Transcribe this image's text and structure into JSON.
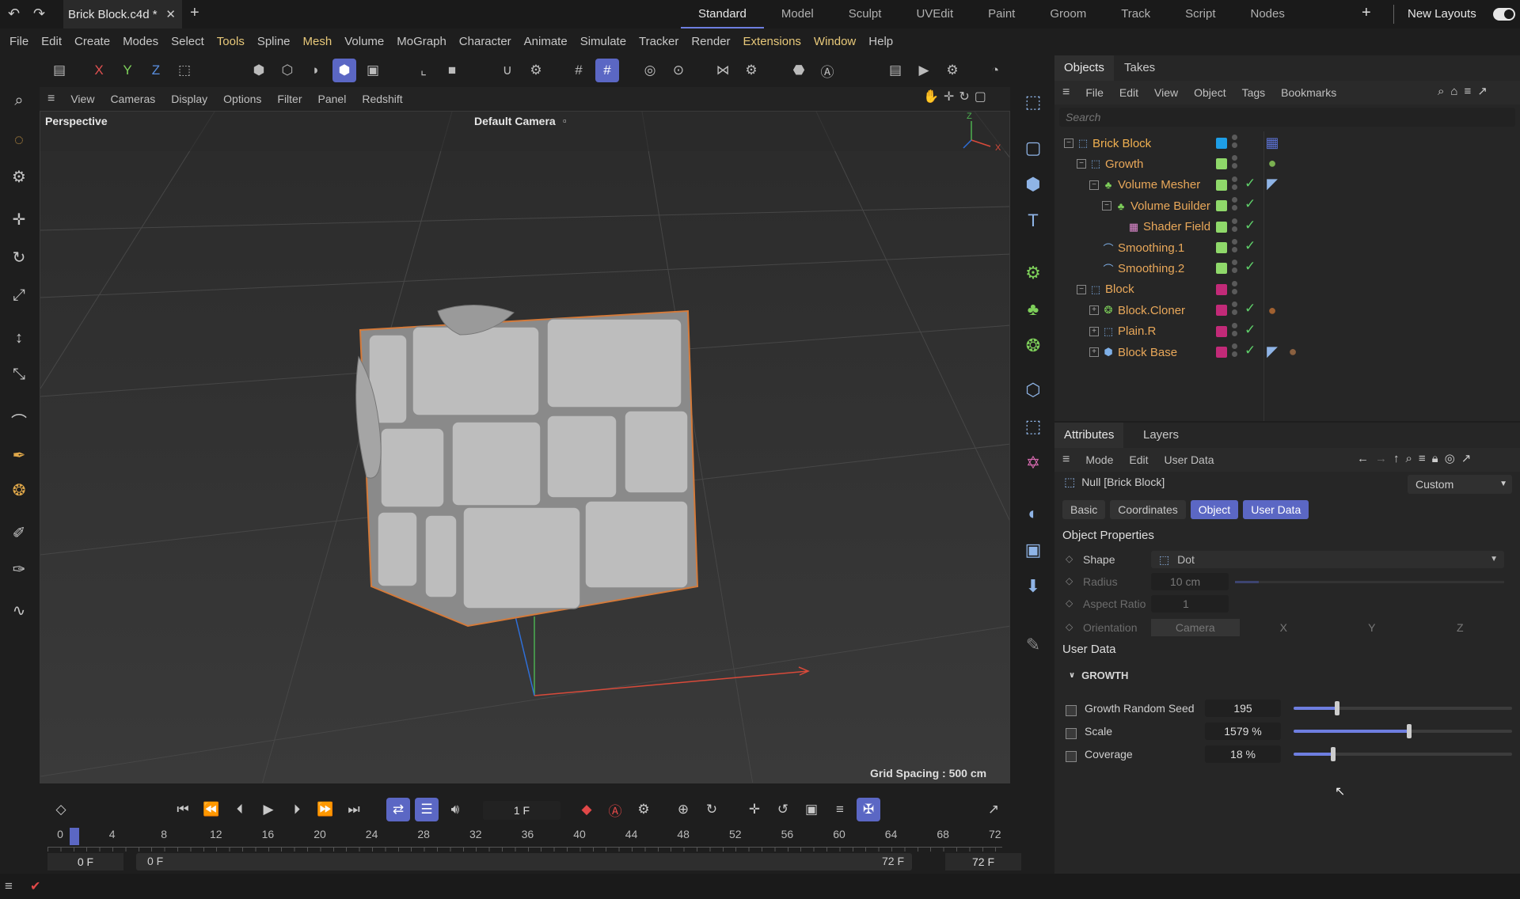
{
  "topbar": {
    "file_tab": "Brick Block.c4d *",
    "layouts": [
      "Standard",
      "Model",
      "Sculpt",
      "UVEdit",
      "Paint",
      "Groom",
      "Track",
      "Script",
      "Nodes"
    ],
    "active_layout": "Standard",
    "new_layouts": "New Layouts"
  },
  "menubar": [
    "File",
    "Edit",
    "Create",
    "Modes",
    "Select",
    "Tools",
    "Spline",
    "Mesh",
    "Volume",
    "MoGraph",
    "Character",
    "Animate",
    "Simulate",
    "Tracker",
    "Render",
    "Extensions",
    "Window",
    "Help"
  ],
  "viewport": {
    "menu": [
      "View",
      "Cameras",
      "Display",
      "Options",
      "Filter",
      "Panel",
      "Redshift"
    ],
    "projection": "Perspective",
    "camera": "Default Camera",
    "grid_spacing": "Grid Spacing : 500 cm",
    "axis_z": "Z",
    "axis_x": "X"
  },
  "objects": {
    "tabs": [
      "Objects",
      "Takes"
    ],
    "menu": [
      "File",
      "Edit",
      "View",
      "Object",
      "Tags",
      "Bookmarks"
    ],
    "search_placeholder": "Search",
    "items": [
      {
        "name": "Brick Block",
        "color": "#1e9ee6",
        "checked": false
      },
      {
        "name": "Growth",
        "color": "#8fd86a",
        "checked": false
      },
      {
        "name": "Volume Mesher",
        "color": "#8fd86a",
        "checked": true
      },
      {
        "name": "Volume Builder",
        "color": "#8fd86a",
        "checked": true
      },
      {
        "name": "Shader Field",
        "color": "#8fd86a",
        "checked": true
      },
      {
        "name": "Smoothing.1",
        "color": "#8fd86a",
        "checked": true
      },
      {
        "name": "Smoothing.2",
        "color": "#8fd86a",
        "checked": true
      },
      {
        "name": "Block",
        "color": "#c22a78",
        "checked": false
      },
      {
        "name": "Block.Cloner",
        "color": "#c22a78",
        "checked": true
      },
      {
        "name": "Plain.R",
        "color": "#c22a78",
        "checked": true
      },
      {
        "name": "Block Base",
        "color": "#c22a78",
        "checked": true
      }
    ]
  },
  "attributes": {
    "tabs": [
      "Attributes",
      "Layers"
    ],
    "menu": [
      "Mode",
      "Edit",
      "User Data"
    ],
    "object_label": "Null [Brick Block]",
    "mode_select": "Custom",
    "buttons": [
      "Basic",
      "Coordinates",
      "Object",
      "User Data"
    ],
    "object_properties_title": "Object Properties",
    "shape_label": "Shape",
    "shape_value": "Dot",
    "radius_label": "Radius",
    "radius_value": "10 cm",
    "aspect_label": "Aspect Ratio",
    "aspect_value": "1",
    "orientation_label": "Orientation",
    "orientation_options": [
      "Camera",
      "X",
      "Y",
      "Z"
    ],
    "user_data_title": "User Data",
    "group_title": "GROWTH",
    "params": [
      {
        "label": "Growth Random Seed",
        "value": "195",
        "fraction": 0.2
      },
      {
        "label": "Scale",
        "value": "1579 %",
        "fraction": 0.53
      },
      {
        "label": "Coverage",
        "value": "18 %",
        "fraction": 0.18
      }
    ]
  },
  "timeline": {
    "current_frame": "1 F",
    "ticks": [
      "0",
      "4",
      "8",
      "12",
      "16",
      "20",
      "24",
      "28",
      "32",
      "36",
      "40",
      "44",
      "48",
      "52",
      "56",
      "60",
      "64",
      "68",
      "72"
    ],
    "start": "0 F",
    "range_start": "0 F",
    "range_end": "72 F",
    "end": "72 F"
  }
}
